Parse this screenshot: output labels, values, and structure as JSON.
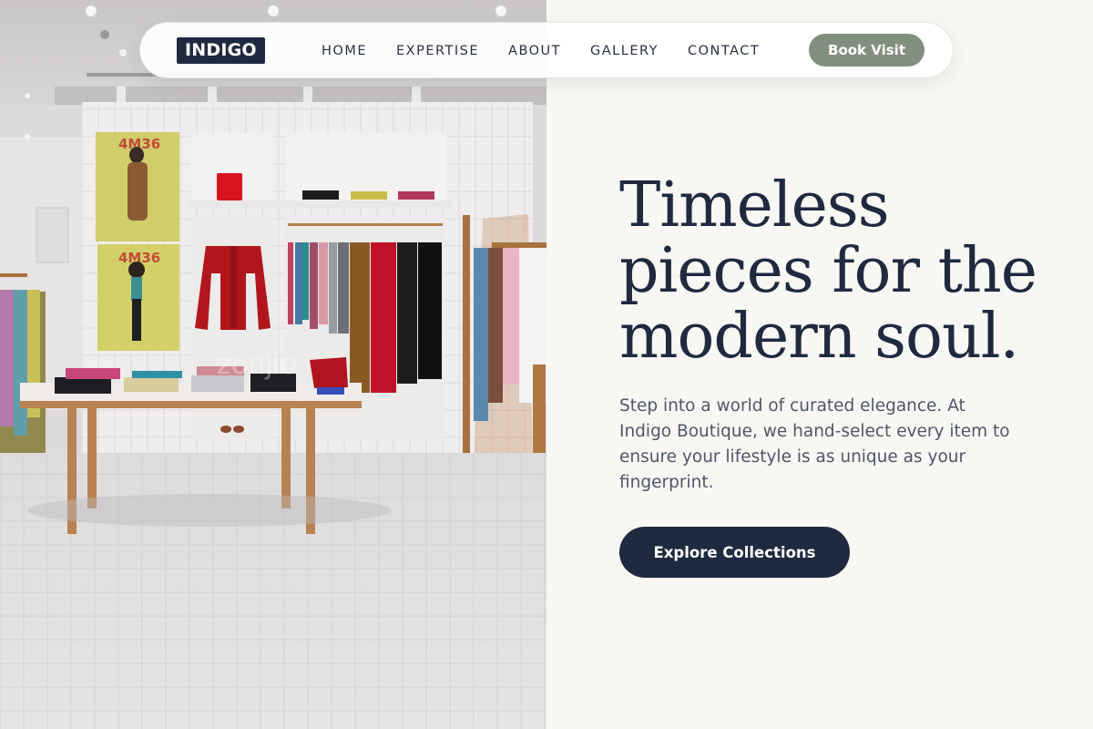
{
  "nav": {
    "logo": "INDIGO",
    "links": [
      "HOME",
      "EXPERTISE",
      "ABOUT",
      "GALLERY",
      "CONTACT"
    ],
    "cta": "Book Visit"
  },
  "hero": {
    "headline_lines": [
      "Timeless",
      "pieces for the",
      "modern soul."
    ],
    "description": "Step into a world of curated elegance. At Indigo Boutique, we hand-select every item to ensure your lifestyle is as unique as your fingerprint.",
    "cta": "Explore Collections"
  },
  "image": {
    "poster_label": "4M36",
    "watermark": "zonjio"
  },
  "colors": {
    "primary": "#1f2a3f",
    "accent": "#838f7e",
    "background": "#f8f7f4"
  }
}
